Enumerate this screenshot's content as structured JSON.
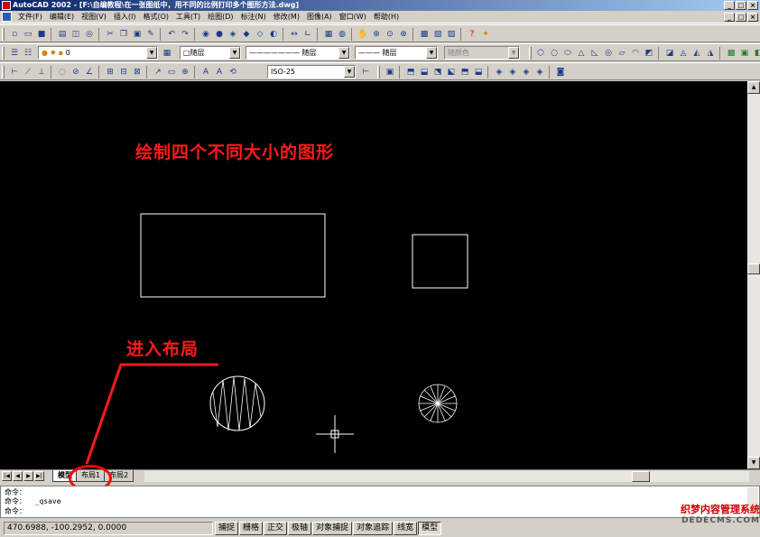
{
  "titlebar": {
    "title": "AutoCAD 2002 - [F:\\自编教程\\在一张图纸中，用不同的比例打印多个图形方法.dwg]"
  },
  "menu": {
    "items": [
      "文件(F)",
      "编辑(E)",
      "视图(V)",
      "插入(I)",
      "格式(O)",
      "工具(T)",
      "绘图(D)",
      "标注(N)",
      "修改(M)",
      "图像(A)",
      "窗口(W)",
      "帮助(H)"
    ]
  },
  "toolbar2": {
    "layer_value": "0",
    "layer_combo": "随层",
    "linetype_combo": "随层",
    "lineweight_combo": "随层",
    "plotstyle_combo": "随颜色"
  },
  "toolbar3": {
    "dimstyle_value": "ISO-25"
  },
  "annotations": {
    "heading": "绘制四个不同大小的图形",
    "layout_note": "进入布局"
  },
  "tabs": [
    "模型",
    "布局1",
    "布局2"
  ],
  "active_tab": "模型",
  "command": {
    "lines": [
      "命令：",
      "命令：  _qsave",
      "命令："
    ]
  },
  "status": {
    "coords": "470.6988, -100.2952, 0.0000",
    "buttons": [
      "捕捉",
      "栅格",
      "正交",
      "极轴",
      "对象捕捉",
      "对象追踪",
      "线宽",
      "模型"
    ]
  },
  "watermark": {
    "line1": "织梦内容管理系统",
    "line2": "DEDECMS.COM"
  },
  "colors": {
    "canvas_bg": "#000000",
    "annotation": "#ff1a1a",
    "shape_stroke": "#ffffff",
    "titlebar": "#0a246a"
  },
  "icons": {
    "toolbar1": [
      "new-icon",
      "open-icon",
      "save-icon",
      "print-icon",
      "preview-icon",
      "find-icon",
      "cut-icon",
      "copy-icon",
      "paste-icon",
      "match-icon",
      "undo-icon",
      "redo-icon",
      "hyperlink-icon",
      "pan-icon",
      "zoom-icon",
      "properties-icon",
      "help-icon"
    ],
    "toolbar_right": [
      "box-icon",
      "sphere-icon",
      "cylinder-icon",
      "cone-icon",
      "wedge-icon",
      "torus-icon",
      "extrude-icon",
      "revolve-icon",
      "slice-icon",
      "section-icon"
    ]
  }
}
